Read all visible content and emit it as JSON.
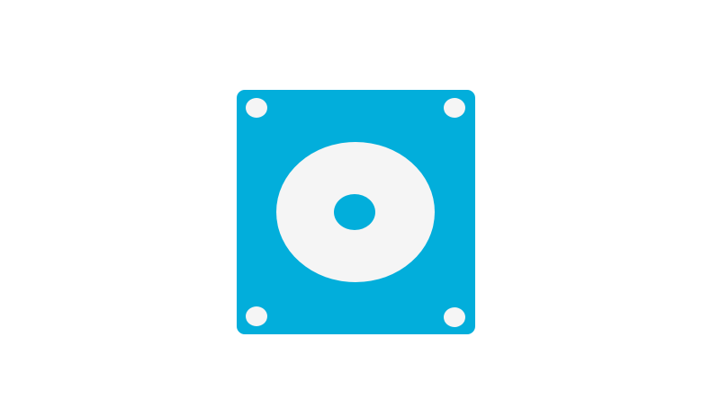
{
  "logo": {
    "icon": "disk-drive-icon",
    "colors": {
      "plate": "#02AEDB",
      "disc": "#F5F5F5",
      "background": "#FFFFFF"
    }
  }
}
